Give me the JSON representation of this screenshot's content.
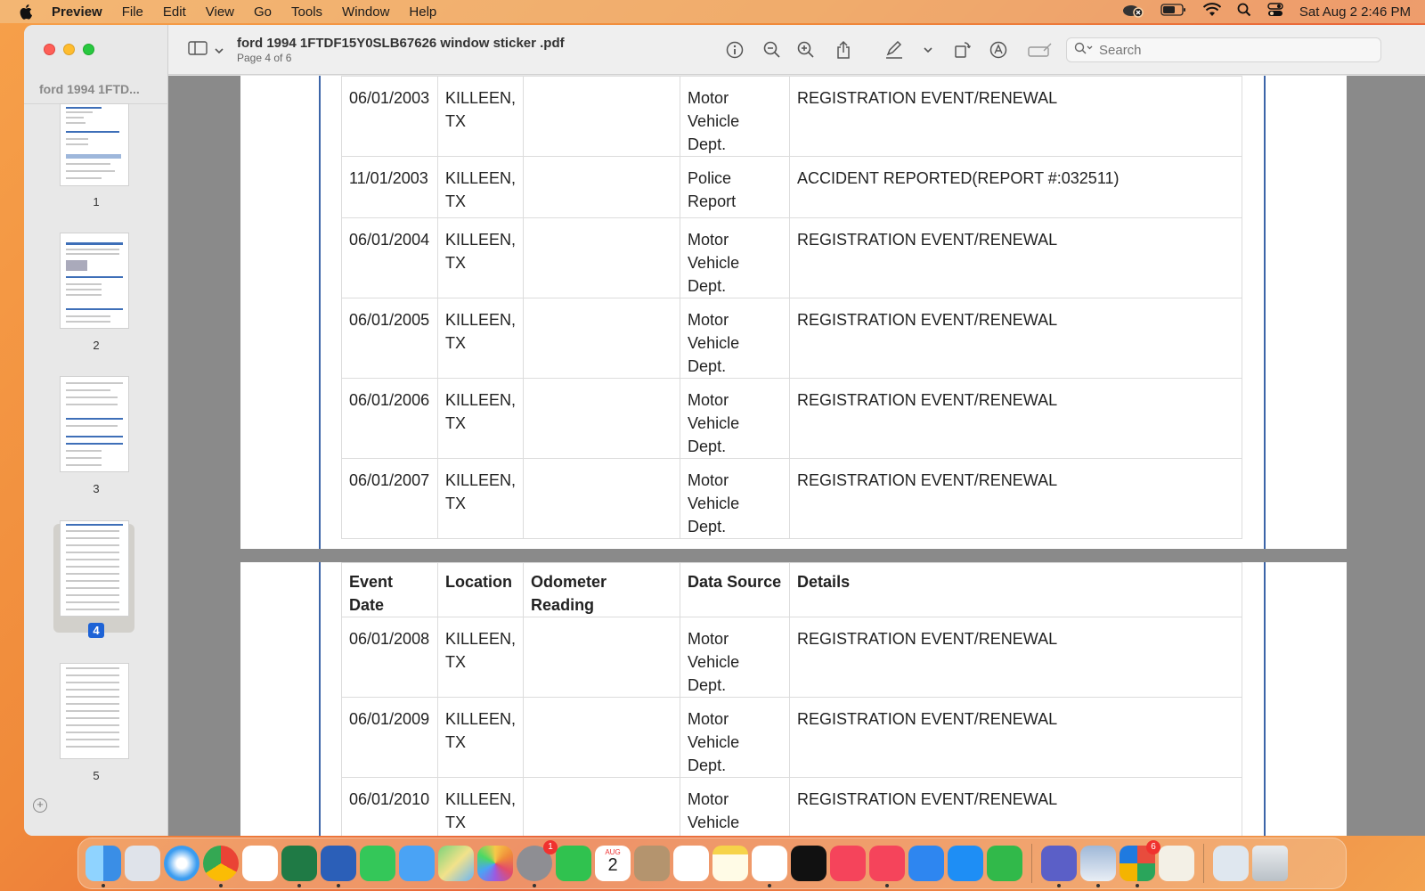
{
  "menubar": {
    "app": "Preview",
    "items": [
      "File",
      "Edit",
      "View",
      "Go",
      "Tools",
      "Window",
      "Help"
    ],
    "clock": "Sat Aug 2  2:46 PM"
  },
  "window": {
    "sidebar_title": "ford 1994 1FTD...",
    "thumbnails": [
      "1",
      "2",
      "3",
      "4",
      "5"
    ],
    "selected_page": "4",
    "title": "ford 1994 1FTDF15Y0SLB67626 window sticker .pdf",
    "subtitle": "Page 4 of 6",
    "search_placeholder": "Search"
  },
  "page_top": {
    "rows": [
      {
        "date": "06/01/2003",
        "location": "KILLEEN, TX",
        "odometer": "",
        "source": "Motor Vehicle Dept.",
        "details": "REGISTRATION EVENT/RENEWAL"
      },
      {
        "date": "11/01/2003",
        "location": "KILLEEN, TX",
        "odometer": "",
        "source": "Police Report",
        "details": "ACCIDENT REPORTED(REPORT #:032511)"
      },
      {
        "date": "06/01/2004",
        "location": "KILLEEN, TX",
        "odometer": "",
        "source": "Motor Vehicle Dept.",
        "details": "REGISTRATION EVENT/RENEWAL"
      },
      {
        "date": "06/01/2005",
        "location": "KILLEEN, TX",
        "odometer": "",
        "source": "Motor Vehicle Dept.",
        "details": "REGISTRATION EVENT/RENEWAL"
      },
      {
        "date": "06/01/2006",
        "location": "KILLEEN, TX",
        "odometer": "",
        "source": "Motor Vehicle Dept.",
        "details": "REGISTRATION EVENT/RENEWAL"
      },
      {
        "date": "06/01/2007",
        "location": "KILLEEN, TX",
        "odometer": "",
        "source": "Motor Vehicle Dept.",
        "details": "REGISTRATION EVENT/RENEWAL"
      }
    ]
  },
  "page_bottom": {
    "headers": [
      "Event Date",
      "Location",
      "Odometer Reading",
      "Data Source",
      "Details"
    ],
    "rows": [
      {
        "date": "06/01/2008",
        "location": "KILLEEN, TX",
        "odometer": "",
        "source": "Motor Vehicle Dept.",
        "details": "REGISTRATION EVENT/RENEWAL"
      },
      {
        "date": "06/01/2009",
        "location": "KILLEEN, TX",
        "odometer": "",
        "source": "Motor Vehicle Dept.",
        "details": "REGISTRATION EVENT/RENEWAL"
      },
      {
        "date": "06/01/2010",
        "location": "KILLEEN, TX",
        "odometer": "",
        "source": "Motor Vehicle Dept.",
        "details": "REGISTRATION EVENT/RENEWAL"
      }
    ]
  },
  "dock": {
    "apps": [
      "Finder",
      "Launchpad",
      "Safari",
      "Chrome",
      "OneDrive",
      "Excel",
      "Word",
      "Messages",
      "Mail",
      "Maps",
      "Photos",
      "System Settings",
      "FaceTime",
      "Calendar",
      "Contacts",
      "Reminders",
      "Notes",
      "Freeform",
      "TV",
      "Music",
      "News",
      "Keynote",
      "App Store",
      "Numbers",
      "Teams",
      "Preview",
      "Microsoft 365",
      "TextEdit",
      "Downloads",
      "Trash"
    ],
    "calendar_month": "AUG",
    "calendar_day": "2",
    "settings_badge": "1",
    "m365_badge": "6"
  },
  "colors": {
    "accent": "#1e63d6",
    "page_border": "#3c65a8"
  }
}
